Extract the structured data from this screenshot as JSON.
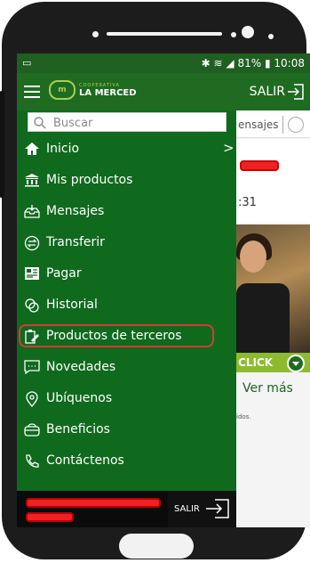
{
  "status_bar": {
    "battery": "81%",
    "time": "10:08"
  },
  "app_bar": {
    "logo_subtitle": "COOPERATIVA",
    "logo_name": "LA MERCED",
    "logout_label": "SALIR"
  },
  "drawer": {
    "search_placeholder": "Buscar",
    "items": [
      {
        "label": "Inicio",
        "icon": "home-icon"
      },
      {
        "label": "Mis productos",
        "icon": "bank-icon"
      },
      {
        "label": "Mensajes",
        "icon": "inbox-icon"
      },
      {
        "label": "Transferir",
        "icon": "transfer-icon"
      },
      {
        "label": "Pagar",
        "icon": "pay-icon"
      },
      {
        "label": "Historial",
        "icon": "history-icon"
      },
      {
        "label": "Productos de terceros",
        "icon": "third-party-icon"
      },
      {
        "label": "Novedades",
        "icon": "chat-icon"
      },
      {
        "label": "Ubíquenos",
        "icon": "location-icon"
      },
      {
        "label": "Beneficios",
        "icon": "bag-icon"
      },
      {
        "label": "Contáctenos",
        "icon": "phone-icon"
      }
    ],
    "footer_logout_label": "SALIR"
  },
  "background": {
    "tab_label": "ensajes",
    "partial_number": ":31",
    "click_banner": "CLICK",
    "see_more": "Ver más",
    "small_text": "idos."
  },
  "colors": {
    "drawer_green": "#0f6a1d",
    "appbar_green": "#1f6b21",
    "accent_lime": "#8dbb2f",
    "highlight_red": "#d23b3b"
  }
}
